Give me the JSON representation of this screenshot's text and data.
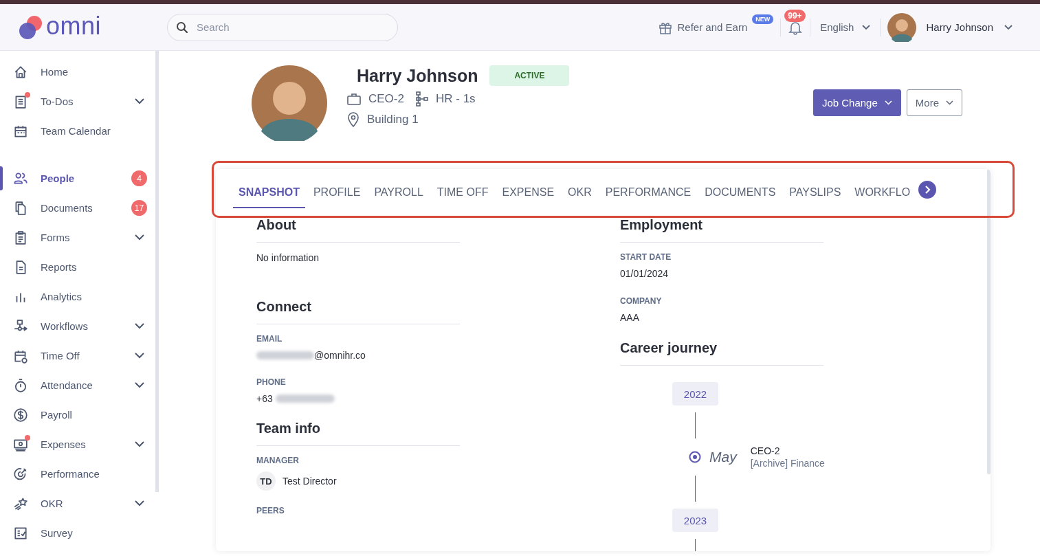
{
  "brand": {
    "name": "omni"
  },
  "search": {
    "placeholder": "Search"
  },
  "header": {
    "refer": "Refer and Earn",
    "refer_badge": "NEW",
    "notifications": "99+",
    "language": "English",
    "user": "Harry Johnson"
  },
  "sidebar": {
    "groups": [
      [
        {
          "label": "Home",
          "selected": false,
          "expandable": false,
          "dot": false
        },
        {
          "label": "To-Dos",
          "selected": false,
          "expandable": true,
          "dot": true
        },
        {
          "label": "Team Calendar",
          "selected": false,
          "expandable": false,
          "dot": false
        }
      ],
      [
        {
          "label": "People",
          "selected": true,
          "expandable": false,
          "dot": false,
          "count": "4"
        },
        {
          "label": "Documents",
          "selected": false,
          "expandable": false,
          "dot": false,
          "count": "17"
        },
        {
          "label": "Forms",
          "selected": false,
          "expandable": true,
          "dot": false
        },
        {
          "label": "Reports",
          "selected": false,
          "expandable": false,
          "dot": false
        },
        {
          "label": "Analytics",
          "selected": false,
          "expandable": false,
          "dot": false
        },
        {
          "label": "Workflows",
          "selected": false,
          "expandable": true,
          "dot": false
        },
        {
          "label": "Time Off",
          "selected": false,
          "expandable": true,
          "dot": false
        },
        {
          "label": "Attendance",
          "selected": false,
          "expandable": true,
          "dot": false
        },
        {
          "label": "Payroll",
          "selected": false,
          "expandable": false,
          "dot": false
        },
        {
          "label": "Expenses",
          "selected": false,
          "expandable": true,
          "dot": true
        },
        {
          "label": "Performance",
          "selected": false,
          "expandable": false,
          "dot": false
        },
        {
          "label": "OKR",
          "selected": false,
          "expandable": true,
          "dot": false
        },
        {
          "label": "Survey",
          "selected": false,
          "expandable": false,
          "dot": false
        }
      ]
    ]
  },
  "profile": {
    "name": "Harry Johnson",
    "status": "ACTIVE",
    "job": "CEO-2",
    "department": "HR - 1s",
    "location": "Building 1"
  },
  "actions": [
    {
      "label": "Job Change",
      "kind": "primary"
    },
    {
      "label": "More",
      "kind": "outline"
    }
  ],
  "tabs": [
    {
      "label": "SNAPSHOT",
      "selected": true
    },
    {
      "label": "PROFILE",
      "selected": false
    },
    {
      "label": "PAYROLL",
      "selected": false
    },
    {
      "label": "TIME OFF",
      "selected": false
    },
    {
      "label": "EXPENSE",
      "selected": false
    },
    {
      "label": "OKR",
      "selected": false
    },
    {
      "label": "PERFORMANCE",
      "selected": false
    },
    {
      "label": "DOCUMENTS",
      "selected": false
    },
    {
      "label": "PAYSLIPS",
      "selected": false
    },
    {
      "label": "WORKFLO",
      "selected": false
    }
  ],
  "about": {
    "title": "About",
    "text": "No information"
  },
  "connect": {
    "title": "Connect",
    "email_label": "EMAIL",
    "email": "@omnihr.co",
    "phone_label": "PHONE",
    "phone": "+63"
  },
  "team_info": {
    "title": "Team info",
    "manager_label": "MANAGER",
    "manager_initials": "TD",
    "manager": "Test Director",
    "peers_label": "PEERS"
  },
  "employment": {
    "title": "Employment",
    "fields": [
      {
        "label": "START DATE",
        "value": "01/01/2024"
      },
      {
        "label": "COMPANY",
        "value": "AAA"
      }
    ]
  },
  "career": {
    "title": "Career journey",
    "timeline": [
      {
        "kind": "year",
        "label": "2022"
      },
      {
        "kind": "event",
        "month": "May",
        "title": "CEO-2",
        "detail": "[Archive] Finance"
      },
      {
        "kind": "year",
        "label": "2023"
      }
    ]
  }
}
